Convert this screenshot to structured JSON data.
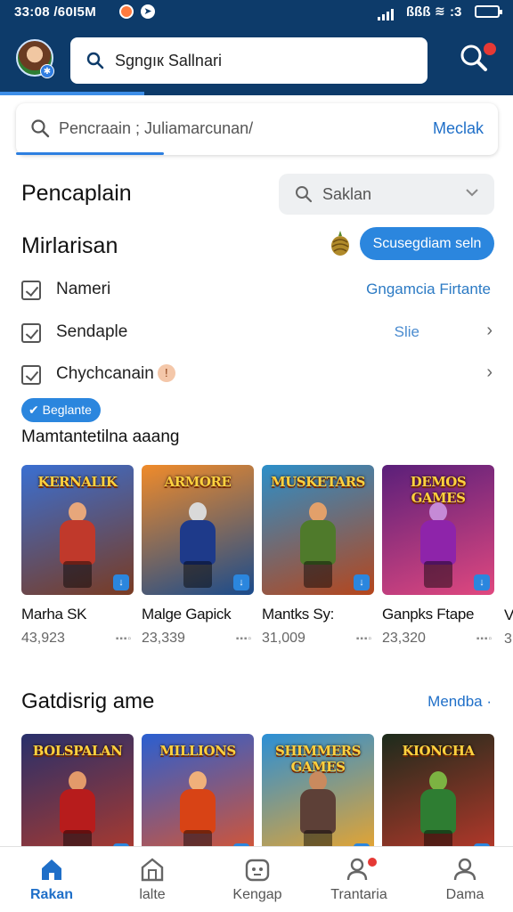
{
  "status_bar": {
    "time": "33:08 /60I5M",
    "right_text": "ßßß",
    "clock": ":3"
  },
  "header": {
    "search_text": "Sgngıк Sallnari"
  },
  "search": {
    "placeholder": "Pencraain ; Juliamarcunan/",
    "action": "Meclak"
  },
  "sort": {
    "heading": "Pencaplain",
    "select_value": "Saklan"
  },
  "filter": {
    "heading": "Mirlarisan",
    "button": "Scusegdiam seln",
    "options": [
      {
        "label": "Nameri",
        "right": "Gngamcia Firtante"
      },
      {
        "label": "Sendaple",
        "right": "Slie"
      },
      {
        "label": "Chychcanain",
        "right": ""
      }
    ],
    "chip": "Beglante",
    "subheading": "Mamtantetilna aaang"
  },
  "games": [
    {
      "title": "Marha SK",
      "count": "43,923",
      "extra": "▪▪▪▫",
      "logo": "KERNALIK",
      "bg_top": "#3a6fd1",
      "bg_bottom": "#7a3b22",
      "accent": "#c0392b",
      "skin": "#e7a77b"
    },
    {
      "title": "Malge Gapick",
      "count": "23,339",
      "extra": "▪▪▪▫",
      "logo": "ARMORE",
      "bg_top": "#f08b2a",
      "bg_bottom": "#1a4b8c",
      "accent": "#1e3a8a",
      "skin": "#d9d9d9"
    },
    {
      "title": "Mantks Sy:",
      "count": "31,009",
      "extra": "▪▪▪▫",
      "logo": "MUSKETARS",
      "bg_top": "#2c8fc9",
      "bg_bottom": "#b6461c",
      "accent": "#4f7a2b",
      "skin": "#e2a06a"
    },
    {
      "title": "Ganpks Ftape",
      "count": "23,320",
      "extra": "▪▪▪▫",
      "logo": "DEMOS GAMES",
      "bg_top": "#5a1f7a",
      "bg_bottom": "#e0487f",
      "accent": "#8e24aa",
      "skin": "#c58ad6"
    }
  ],
  "peek": {
    "title": "V",
    "count": "3"
  },
  "popular": {
    "heading": "Gatdisrig ame",
    "link": "Mendba ·",
    "games": [
      {
        "logo": "BOLSPALAN",
        "bg_top": "#28306b",
        "bg_bottom": "#b33a2a",
        "accent": "#b71c1c",
        "skin": "#e39a6a"
      },
      {
        "logo": "MILLIONS",
        "bg_top": "#2a5fd1",
        "bg_bottom": "#e0542a",
        "accent": "#d84315",
        "skin": "#f0b07a"
      },
      {
        "logo": "SHIMMERS GAMES",
        "bg_top": "#2b8fd6",
        "bg_bottom": "#f5a623",
        "accent": "#5d4037",
        "skin": "#c98a5e"
      },
      {
        "logo": "KIONCHA",
        "bg_top": "#1c2b1c",
        "bg_bottom": "#c0392b",
        "accent": "#2e7d32",
        "skin": "#7cb342"
      }
    ]
  },
  "nav": [
    {
      "label": "Rakan",
      "icon": "home-icon",
      "active": true
    },
    {
      "label": "lalte",
      "icon": "store-icon",
      "active": false
    },
    {
      "label": "Kengap",
      "icon": "gamepad-icon",
      "active": false
    },
    {
      "label": "Trantaria",
      "icon": "friends-icon",
      "active": false
    },
    {
      "label": "Dama",
      "icon": "profile-icon",
      "active": false
    }
  ],
  "colors": {
    "header_bg": "#0d3b6a",
    "accent": "#2b86de",
    "link": "#1f6fc8"
  }
}
